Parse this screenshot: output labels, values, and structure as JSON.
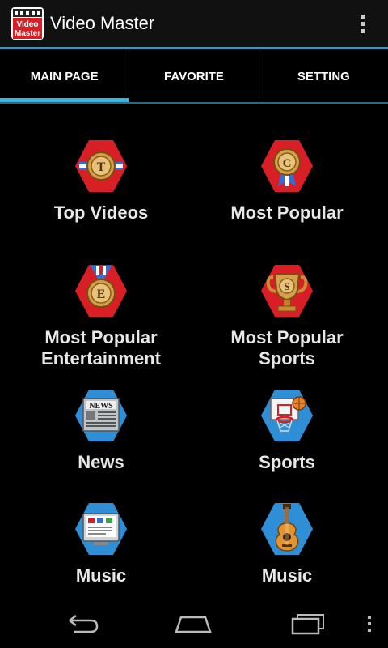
{
  "app": {
    "title": "Video Master",
    "icon_text_line1": "Video",
    "icon_text_line2": "Master",
    "icon_name": "video-master-logo-icon"
  },
  "tabs": [
    {
      "label": "MAIN PAGE",
      "active": true
    },
    {
      "label": "FAVORITE",
      "active": false
    },
    {
      "label": "SETTING",
      "active": false
    }
  ],
  "grid": {
    "items": [
      {
        "label": "Top Videos",
        "icon": "top-videos-medal-icon",
        "badge_letter": "T"
      },
      {
        "label": "Most Popular",
        "icon": "most-popular-medal-icon",
        "badge_letter": "C"
      },
      {
        "label": "Most Popular Entertainment",
        "label_line1": "Most Popular",
        "label_line2": "Entertainment",
        "icon": "entertainment-medal-icon",
        "badge_letter": "E"
      },
      {
        "label": "Most Popular Sports",
        "label_line1": "Most Popular",
        "label_line2": "Sports",
        "icon": "sports-trophy-icon",
        "badge_letter": "S"
      },
      {
        "label": "News",
        "icon": "newspaper-icon",
        "badge_text": "NEWS"
      },
      {
        "label": "Sports",
        "icon": "basketball-hoop-icon"
      },
      {
        "label": "Music",
        "icon": "music-tv-icon"
      },
      {
        "label": "Music",
        "icon": "guitar-icon"
      }
    ]
  },
  "colors": {
    "accent": "#33b5e5",
    "red_hex": "#d81f26",
    "blue_hex": "#2f8fd6"
  },
  "nav": {
    "back_icon": "back-icon",
    "home_icon": "home-icon",
    "recents_icon": "recent-apps-icon",
    "menu_icon": "overflow-menu-icon"
  }
}
